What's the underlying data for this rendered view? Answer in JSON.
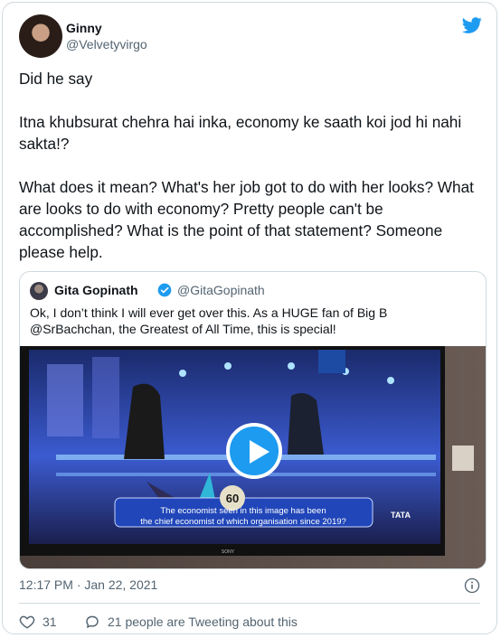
{
  "author": {
    "name": "Ginny",
    "handle": "@Velvetyvirgo"
  },
  "tweet": {
    "paragraphs": [
      "Did he say",
      "Itna khubsurat chehra hai inka, economy ke saath koi jod hi nahi sakta!?",
      "What does it mean? What's her job got to do with her looks? What are looks to do with economy? Pretty people can't be accomplished? What is the point of that statement? Someone please help."
    ]
  },
  "quoted": {
    "name": "Gita Gopinath",
    "handle": "@GitaGopinath",
    "text": "Ok, I don’t think I will ever get over this. As a HUGE fan of Big B @SrBachchan, the Greatest of All Time, this is special!",
    "media": {
      "lifeline_number": "60",
      "question_line1": "The economist seen in this image has been",
      "question_line2": "the chief economist of which organisation since 2019?",
      "brand": "TATA",
      "tv_brand": "SONY"
    }
  },
  "meta": {
    "timestamp": "12:17 PM · Jan 22, 2021"
  },
  "actions": {
    "likes": "31",
    "conversation": "21 people are Tweeting about this"
  },
  "colors": {
    "accent": "#1d9bf0",
    "muted": "#536471",
    "border": "#cfd9de"
  }
}
